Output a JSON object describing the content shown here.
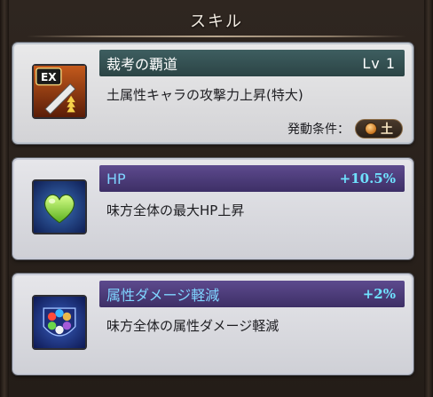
{
  "header": {
    "title": "スキル"
  },
  "skills": [
    {
      "name": "裁考の覇道",
      "level": "Lv 1",
      "description": "土属性キャラの攻撃力上昇(特大)",
      "condition_label": "発動条件：",
      "condition_element": "土",
      "icon_text": "EX",
      "icon": "ex-sword-icon"
    },
    {
      "name": "HP",
      "bonus": "+10.5%",
      "description": "味方全体の最大HP上昇",
      "icon": "heart-icon"
    },
    {
      "name": "属性ダメージ軽減",
      "bonus": "+2%",
      "description": "味方全体の属性ダメージ軽減",
      "icon": "element-orbs-icon"
    }
  ],
  "colors": {
    "support_title": "#7fd4ff",
    "bonus": "#6fe2ff",
    "skill_bar": "#2b4445",
    "support_bar": "#3d2f66"
  }
}
